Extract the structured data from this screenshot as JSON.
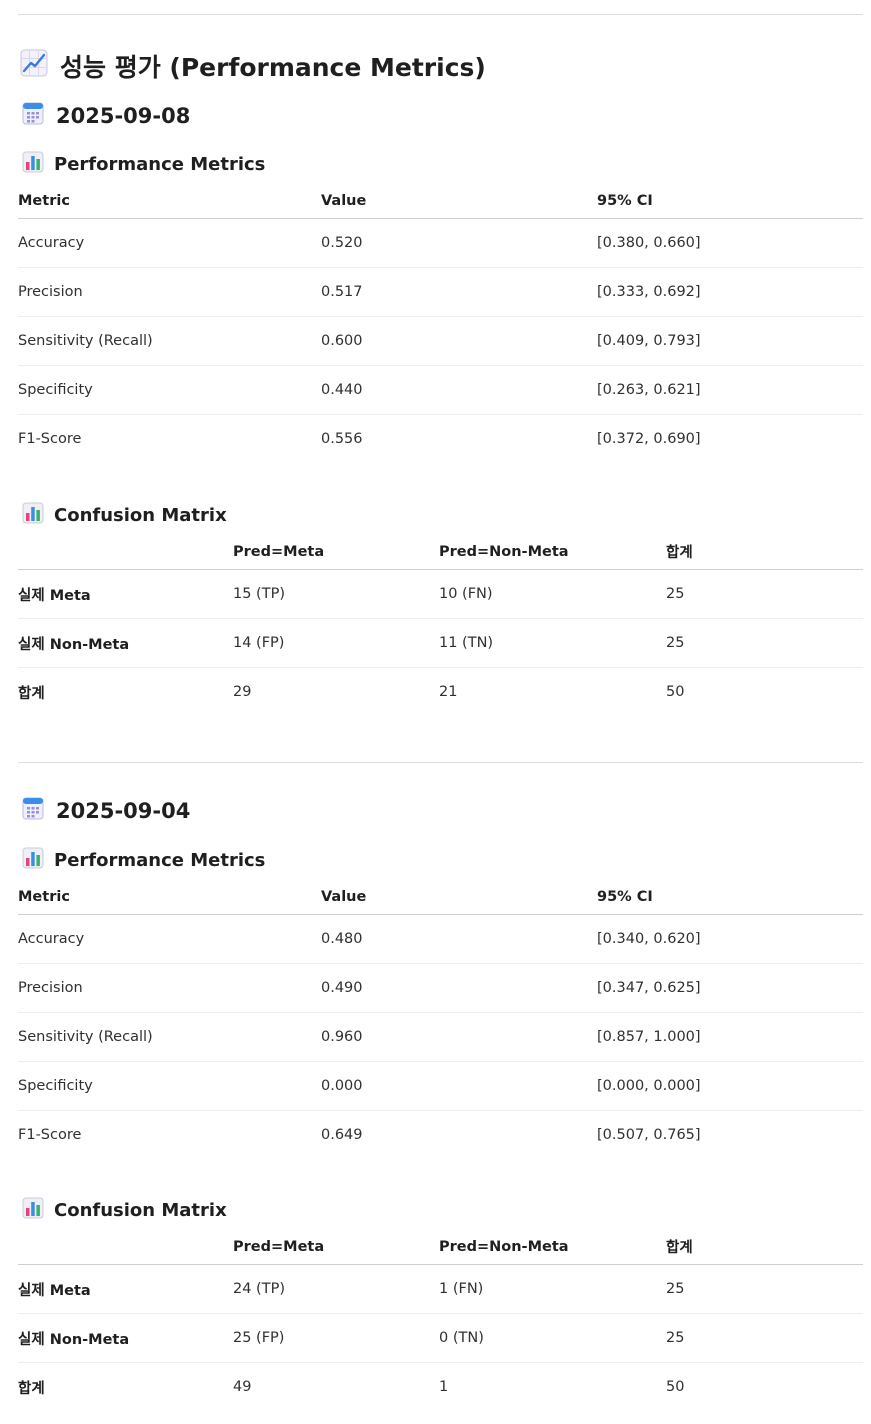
{
  "page": {
    "title": "성능 평가 (Performance Metrics)",
    "title_icon": "chart-increasing-icon"
  },
  "sections": [
    {
      "date": "2025-09-08",
      "date_icon": "calendar-icon",
      "metrics": {
        "heading": "Performance Metrics",
        "heading_icon": "bar-chart-icon",
        "columns": [
          "Metric",
          "Value",
          "95% CI"
        ],
        "rows": [
          [
            "Accuracy",
            "0.520",
            "[0.380, 0.660]"
          ],
          [
            "Precision",
            "0.517",
            "[0.333, 0.692]"
          ],
          [
            "Sensitivity (Recall)",
            "0.600",
            "[0.409, 0.793]"
          ],
          [
            "Specificity",
            "0.440",
            "[0.263, 0.621]"
          ],
          [
            "F1-Score",
            "0.556",
            "[0.372, 0.690]"
          ]
        ]
      },
      "confusion": {
        "heading": "Confusion Matrix",
        "heading_icon": "bar-chart-icon",
        "columns": [
          "",
          "Pred=Meta",
          "Pred=Non-Meta",
          "합계"
        ],
        "rows": [
          [
            "실제 Meta",
            "15 (TP)",
            "10 (FN)",
            "25"
          ],
          [
            "실제 Non-Meta",
            "14 (FP)",
            "11 (TN)",
            "25"
          ],
          [
            "합계",
            "29",
            "21",
            "50"
          ]
        ]
      }
    },
    {
      "date": "2025-09-04",
      "date_icon": "calendar-icon",
      "metrics": {
        "heading": "Performance Metrics",
        "heading_icon": "bar-chart-icon",
        "columns": [
          "Metric",
          "Value",
          "95% CI"
        ],
        "rows": [
          [
            "Accuracy",
            "0.480",
            "[0.340, 0.620]"
          ],
          [
            "Precision",
            "0.490",
            "[0.347, 0.625]"
          ],
          [
            "Sensitivity (Recall)",
            "0.960",
            "[0.857, 1.000]"
          ],
          [
            "Specificity",
            "0.000",
            "[0.000, 0.000]"
          ],
          [
            "F1-Score",
            "0.649",
            "[0.507, 0.765]"
          ]
        ]
      },
      "confusion": {
        "heading": "Confusion Matrix",
        "heading_icon": "bar-chart-icon",
        "columns": [
          "",
          "Pred=Meta",
          "Pred=Non-Meta",
          "합계"
        ],
        "rows": [
          [
            "실제 Meta",
            "24 (TP)",
            "1 (FN)",
            "25"
          ],
          [
            "실제 Non-Meta",
            "25 (FP)",
            "0 (TN)",
            "25"
          ],
          [
            "합계",
            "49",
            "1",
            "50"
          ]
        ]
      }
    }
  ]
}
